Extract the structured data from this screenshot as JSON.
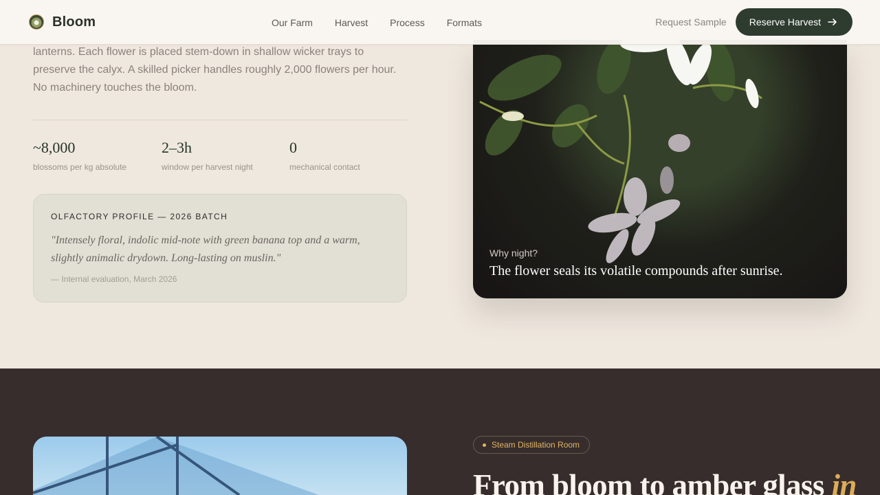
{
  "brand": {
    "name": "Bloom",
    "logo_icon": "jasmine-logo-icon"
  },
  "nav": {
    "links": [
      "Our Farm",
      "Harvest",
      "Process",
      "Formats"
    ],
    "request_label": "Request Sample",
    "reserve_label": "Reserve Harvest",
    "reserve_icon": "arrow-right-icon"
  },
  "harvest": {
    "intro": "lanterns. Each flower is placed stem-down in shallow wicker trays to preserve the calyx. A skilled picker handles roughly 2,000 flowers per hour. No machinery touches the bloom.",
    "stats": [
      {
        "value": "~8,000",
        "label": "blossoms per kg absolute"
      },
      {
        "value": "2–3h",
        "label": "window per harvest night"
      },
      {
        "value": "0",
        "label": "mechanical contact"
      }
    ],
    "profile": {
      "title": "OLFACTORY PROFILE — 2026 BATCH",
      "quote": "\"Intensely floral, indolic mid-note with green banana top and a warm, slightly animalic drydown. Long-lasting on muslin.\"",
      "credit": "— Internal evaluation, March 2026"
    },
    "photo": {
      "question": "Why night?",
      "answer": "The flower seals its volatile compounds after sunrise."
    }
  },
  "distillation": {
    "pill": "Steam Distillation Room",
    "headline_start": "From bloom to amber glass",
    "headline_accent": "in"
  },
  "colors": {
    "accent_green": "#2e3b2f",
    "accent_gold": "#dcad59",
    "background": "#efe8df",
    "dark": "#372d2d"
  }
}
